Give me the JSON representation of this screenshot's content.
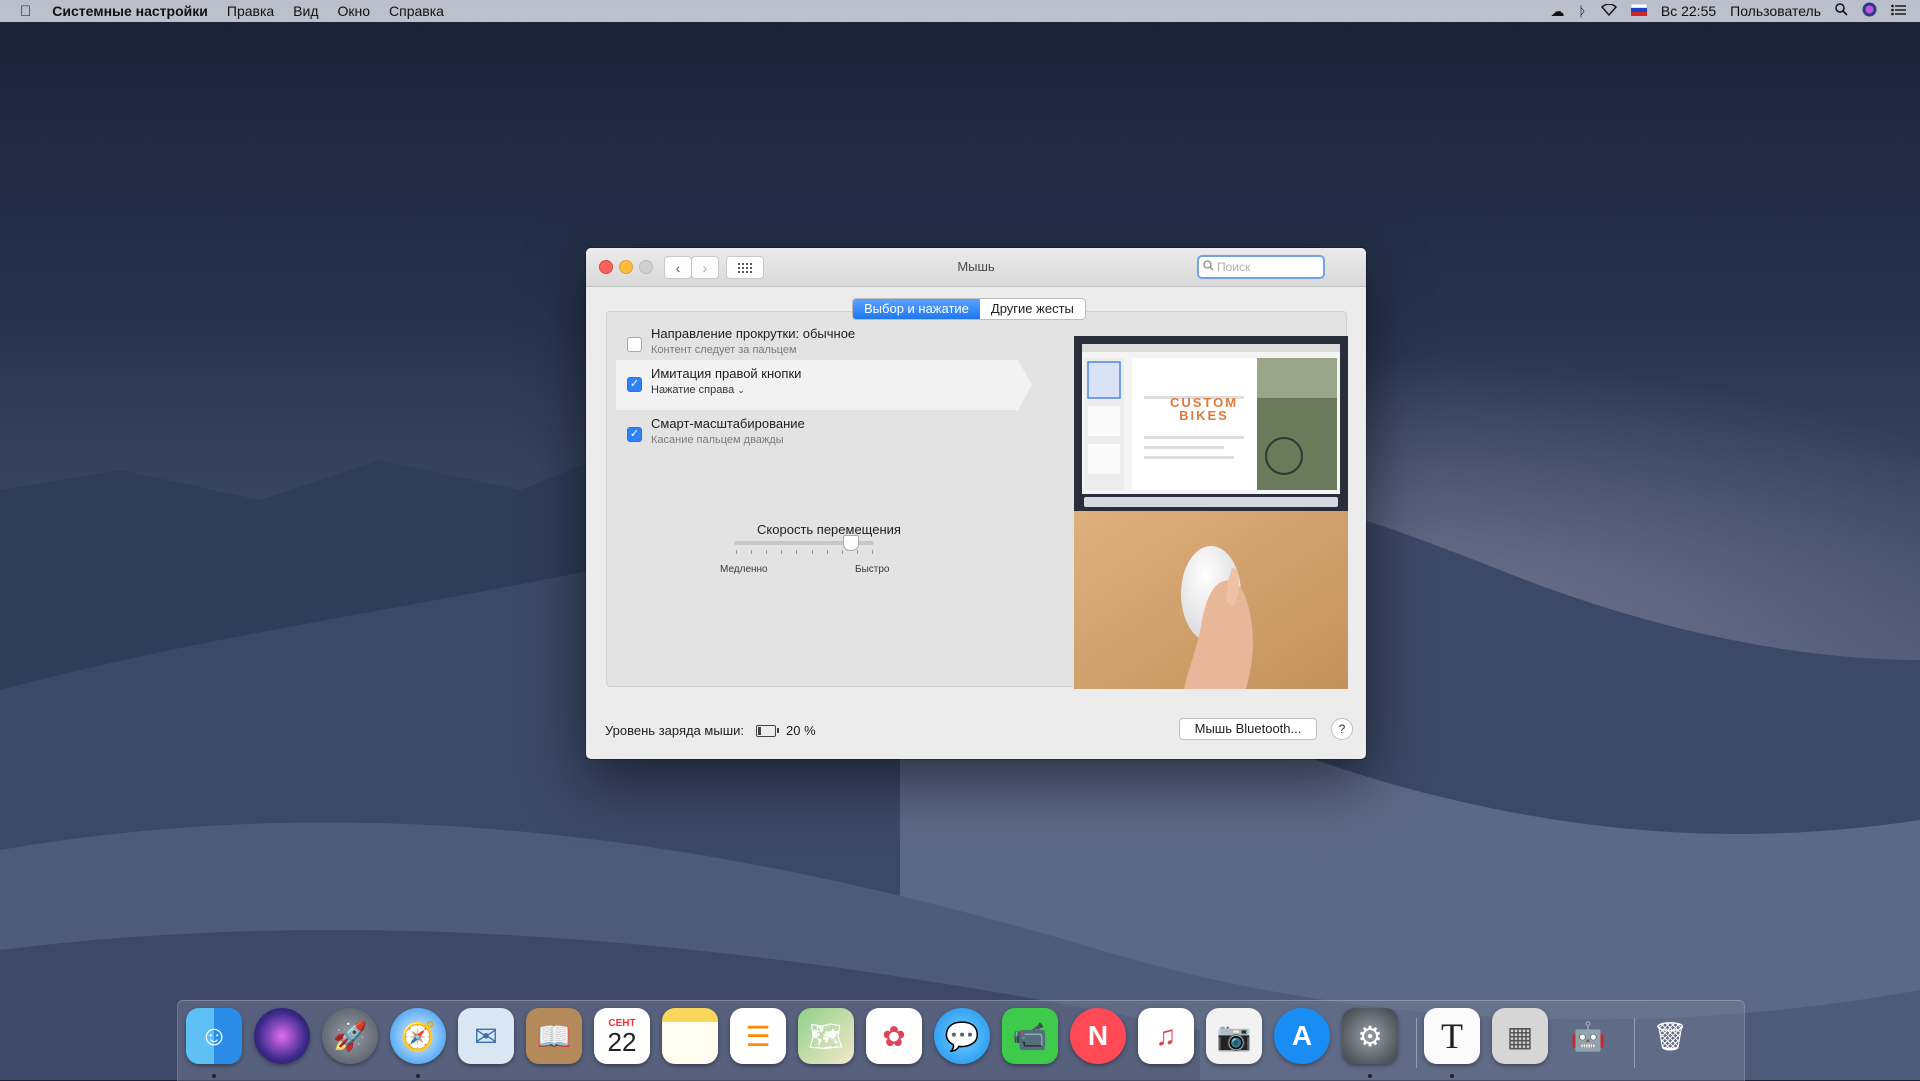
{
  "menubar": {
    "app_name": "Системные настройки",
    "menus": [
      "Правка",
      "Вид",
      "Окно",
      "Справка"
    ],
    "clock": "Вс 22:55",
    "user": "Пользователь"
  },
  "window": {
    "title": "Мышь",
    "search_placeholder": "Поиск",
    "tabs": [
      {
        "label": "Выбор и нажатие",
        "selected": true
      },
      {
        "label": "Другие жесты",
        "selected": false
      }
    ],
    "options": [
      {
        "title": "Направление прокрутки: обычное",
        "subtitle": "Контент следует за пальцем",
        "checked": false
      },
      {
        "title": "Имитация правой кнопки",
        "subtitle": "Нажатие справа",
        "checked": true
      },
      {
        "title": "Смарт-масштабирование",
        "subtitle": "Касание пальцем дважды",
        "checked": true
      }
    ],
    "speed": {
      "label": "Скорость перемещения",
      "min_label": "Медленно",
      "max_label": "Быстро",
      "value_fraction": 0.83,
      "tick_count": 10
    },
    "preview_text": "CUSTOM BIKES",
    "battery_label": "Уровень заряда мыши:",
    "battery_percent": "20 %",
    "battery_level": 0.2,
    "bluetooth_button": "Мышь Bluetooth...",
    "help_button": "?"
  },
  "dock": {
    "calendar_month": "СЕНТ",
    "calendar_day": "22",
    "textedit_glyph": "T"
  },
  "colors": {
    "accent": "#2f82f5",
    "close": "#fc605c",
    "minimize": "#fdbc40"
  }
}
